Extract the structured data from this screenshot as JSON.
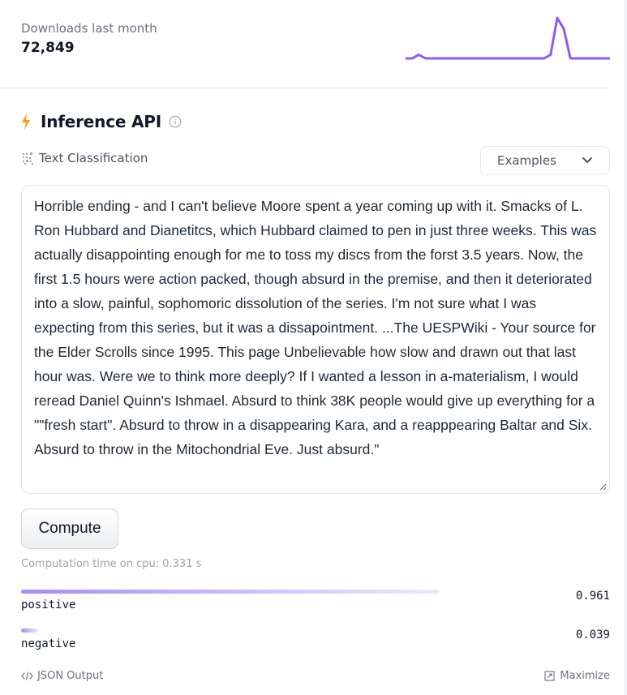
{
  "downloads": {
    "label": "Downloads last month",
    "value": "72,849"
  },
  "sparkline": {
    "color": "#8b5cf6",
    "values": [
      1,
      1,
      2,
      1,
      1,
      1,
      1,
      1,
      1,
      1,
      1,
      1,
      1,
      1,
      1,
      1,
      1,
      1,
      1,
      1,
      1,
      1,
      2,
      12,
      9,
      1,
      1,
      1,
      1,
      1,
      1,
      1
    ]
  },
  "inference": {
    "title": "Inference API",
    "accent_color": "#f59e0b",
    "task_label": "Text Classification",
    "examples_label": "Examples",
    "input_text": "Horrible ending - and I can't believe Moore spent a year coming up with it. Smacks of L. Ron Hubbard and Dianetitcs, which Hubbard claimed to pen in just three weeks. This was actually disappointing enough for me to toss my discs from the forst 3.5 years. Now, the first 1.5 hours were action packed, though absurd in the premise, and then it deteriorated into a slow, painful, sophomoric dissolution of the series. I'm not sure what I was expecting from this series, but it was a dissapointment. ...The UESPWiki - Your source for the Elder Scrolls since 1995. This page Unbelievable how slow and drawn out that last hour was. Were we to think more deeply? If I wanted a lesson in a-materialism, I would reread Daniel Quinn's Ishmael. Absurd to think 38K people would give up everything for a \"\"fresh start\". Absurd to throw in a disappearing Kara, and a reapppearing Baltar and Six. Absurd to throw in the Mitochondrial Eve. Just absurd.\"",
    "compute_label": "Compute",
    "computation_time": "Computation time on cpu: 0.331 s",
    "results": [
      {
        "label": "positive",
        "score": 0.961,
        "score_text": "0.961"
      },
      {
        "label": "negative",
        "score": 0.039,
        "score_text": "0.039"
      }
    ],
    "json_output_label": "JSON Output",
    "maximize_label": "Maximize"
  }
}
